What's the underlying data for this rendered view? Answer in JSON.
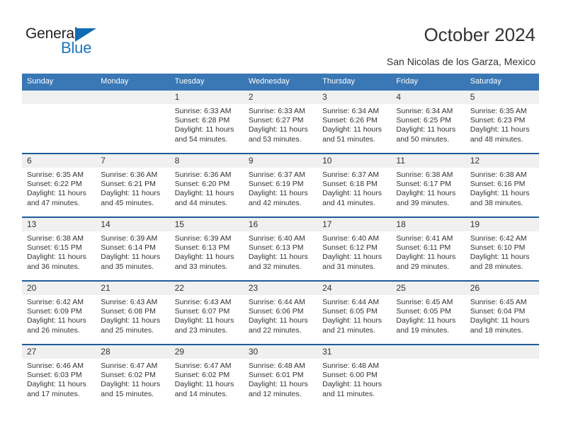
{
  "brand": {
    "name_part1": "General",
    "name_part2": "Blue",
    "triangle_color": "#0f6cb5",
    "blue_color": "#1b76bc"
  },
  "header": {
    "title": "October 2024",
    "subtitle": "San Nicolas de los Garza, Mexico"
  },
  "theme": {
    "header_blue": "#3a77b5",
    "row_divider_blue": "#1f5c99",
    "daynum_band_gray": "#f0f0f0",
    "text": "#333333"
  },
  "weekday_headers": [
    "Sunday",
    "Monday",
    "Tuesday",
    "Wednesday",
    "Thursday",
    "Friday",
    "Saturday"
  ],
  "weeks": [
    [
      {
        "day": "",
        "sunrise": "",
        "sunset": "",
        "daylight_line1": "",
        "daylight_line2": ""
      },
      {
        "day": "",
        "sunrise": "",
        "sunset": "",
        "daylight_line1": "",
        "daylight_line2": ""
      },
      {
        "day": "1",
        "sunrise": "Sunrise: 6:33 AM",
        "sunset": "Sunset: 6:28 PM",
        "daylight_line1": "Daylight: 11 hours",
        "daylight_line2": "and 54 minutes."
      },
      {
        "day": "2",
        "sunrise": "Sunrise: 6:33 AM",
        "sunset": "Sunset: 6:27 PM",
        "daylight_line1": "Daylight: 11 hours",
        "daylight_line2": "and 53 minutes."
      },
      {
        "day": "3",
        "sunrise": "Sunrise: 6:34 AM",
        "sunset": "Sunset: 6:26 PM",
        "daylight_line1": "Daylight: 11 hours",
        "daylight_line2": "and 51 minutes."
      },
      {
        "day": "4",
        "sunrise": "Sunrise: 6:34 AM",
        "sunset": "Sunset: 6:25 PM",
        "daylight_line1": "Daylight: 11 hours",
        "daylight_line2": "and 50 minutes."
      },
      {
        "day": "5",
        "sunrise": "Sunrise: 6:35 AM",
        "sunset": "Sunset: 6:23 PM",
        "daylight_line1": "Daylight: 11 hours",
        "daylight_line2": "and 48 minutes."
      }
    ],
    [
      {
        "day": "6",
        "sunrise": "Sunrise: 6:35 AM",
        "sunset": "Sunset: 6:22 PM",
        "daylight_line1": "Daylight: 11 hours",
        "daylight_line2": "and 47 minutes."
      },
      {
        "day": "7",
        "sunrise": "Sunrise: 6:36 AM",
        "sunset": "Sunset: 6:21 PM",
        "daylight_line1": "Daylight: 11 hours",
        "daylight_line2": "and 45 minutes."
      },
      {
        "day": "8",
        "sunrise": "Sunrise: 6:36 AM",
        "sunset": "Sunset: 6:20 PM",
        "daylight_line1": "Daylight: 11 hours",
        "daylight_line2": "and 44 minutes."
      },
      {
        "day": "9",
        "sunrise": "Sunrise: 6:37 AM",
        "sunset": "Sunset: 6:19 PM",
        "daylight_line1": "Daylight: 11 hours",
        "daylight_line2": "and 42 minutes."
      },
      {
        "day": "10",
        "sunrise": "Sunrise: 6:37 AM",
        "sunset": "Sunset: 6:18 PM",
        "daylight_line1": "Daylight: 11 hours",
        "daylight_line2": "and 41 minutes."
      },
      {
        "day": "11",
        "sunrise": "Sunrise: 6:38 AM",
        "sunset": "Sunset: 6:17 PM",
        "daylight_line1": "Daylight: 11 hours",
        "daylight_line2": "and 39 minutes."
      },
      {
        "day": "12",
        "sunrise": "Sunrise: 6:38 AM",
        "sunset": "Sunset: 6:16 PM",
        "daylight_line1": "Daylight: 11 hours",
        "daylight_line2": "and 38 minutes."
      }
    ],
    [
      {
        "day": "13",
        "sunrise": "Sunrise: 6:38 AM",
        "sunset": "Sunset: 6:15 PM",
        "daylight_line1": "Daylight: 11 hours",
        "daylight_line2": "and 36 minutes."
      },
      {
        "day": "14",
        "sunrise": "Sunrise: 6:39 AM",
        "sunset": "Sunset: 6:14 PM",
        "daylight_line1": "Daylight: 11 hours",
        "daylight_line2": "and 35 minutes."
      },
      {
        "day": "15",
        "sunrise": "Sunrise: 6:39 AM",
        "sunset": "Sunset: 6:13 PM",
        "daylight_line1": "Daylight: 11 hours",
        "daylight_line2": "and 33 minutes."
      },
      {
        "day": "16",
        "sunrise": "Sunrise: 6:40 AM",
        "sunset": "Sunset: 6:13 PM",
        "daylight_line1": "Daylight: 11 hours",
        "daylight_line2": "and 32 minutes."
      },
      {
        "day": "17",
        "sunrise": "Sunrise: 6:40 AM",
        "sunset": "Sunset: 6:12 PM",
        "daylight_line1": "Daylight: 11 hours",
        "daylight_line2": "and 31 minutes."
      },
      {
        "day": "18",
        "sunrise": "Sunrise: 6:41 AM",
        "sunset": "Sunset: 6:11 PM",
        "daylight_line1": "Daylight: 11 hours",
        "daylight_line2": "and 29 minutes."
      },
      {
        "day": "19",
        "sunrise": "Sunrise: 6:42 AM",
        "sunset": "Sunset: 6:10 PM",
        "daylight_line1": "Daylight: 11 hours",
        "daylight_line2": "and 28 minutes."
      }
    ],
    [
      {
        "day": "20",
        "sunrise": "Sunrise: 6:42 AM",
        "sunset": "Sunset: 6:09 PM",
        "daylight_line1": "Daylight: 11 hours",
        "daylight_line2": "and 26 minutes."
      },
      {
        "day": "21",
        "sunrise": "Sunrise: 6:43 AM",
        "sunset": "Sunset: 6:08 PM",
        "daylight_line1": "Daylight: 11 hours",
        "daylight_line2": "and 25 minutes."
      },
      {
        "day": "22",
        "sunrise": "Sunrise: 6:43 AM",
        "sunset": "Sunset: 6:07 PM",
        "daylight_line1": "Daylight: 11 hours",
        "daylight_line2": "and 23 minutes."
      },
      {
        "day": "23",
        "sunrise": "Sunrise: 6:44 AM",
        "sunset": "Sunset: 6:06 PM",
        "daylight_line1": "Daylight: 11 hours",
        "daylight_line2": "and 22 minutes."
      },
      {
        "day": "24",
        "sunrise": "Sunrise: 6:44 AM",
        "sunset": "Sunset: 6:05 PM",
        "daylight_line1": "Daylight: 11 hours",
        "daylight_line2": "and 21 minutes."
      },
      {
        "day": "25",
        "sunrise": "Sunrise: 6:45 AM",
        "sunset": "Sunset: 6:05 PM",
        "daylight_line1": "Daylight: 11 hours",
        "daylight_line2": "and 19 minutes."
      },
      {
        "day": "26",
        "sunrise": "Sunrise: 6:45 AM",
        "sunset": "Sunset: 6:04 PM",
        "daylight_line1": "Daylight: 11 hours",
        "daylight_line2": "and 18 minutes."
      }
    ],
    [
      {
        "day": "27",
        "sunrise": "Sunrise: 6:46 AM",
        "sunset": "Sunset: 6:03 PM",
        "daylight_line1": "Daylight: 11 hours",
        "daylight_line2": "and 17 minutes."
      },
      {
        "day": "28",
        "sunrise": "Sunrise: 6:47 AM",
        "sunset": "Sunset: 6:02 PM",
        "daylight_line1": "Daylight: 11 hours",
        "daylight_line2": "and 15 minutes."
      },
      {
        "day": "29",
        "sunrise": "Sunrise: 6:47 AM",
        "sunset": "Sunset: 6:02 PM",
        "daylight_line1": "Daylight: 11 hours",
        "daylight_line2": "and 14 minutes."
      },
      {
        "day": "30",
        "sunrise": "Sunrise: 6:48 AM",
        "sunset": "Sunset: 6:01 PM",
        "daylight_line1": "Daylight: 11 hours",
        "daylight_line2": "and 12 minutes."
      },
      {
        "day": "31",
        "sunrise": "Sunrise: 6:48 AM",
        "sunset": "Sunset: 6:00 PM",
        "daylight_line1": "Daylight: 11 hours",
        "daylight_line2": "and 11 minutes."
      },
      {
        "day": "",
        "sunrise": "",
        "sunset": "",
        "daylight_line1": "",
        "daylight_line2": ""
      },
      {
        "day": "",
        "sunrise": "",
        "sunset": "",
        "daylight_line1": "",
        "daylight_line2": ""
      }
    ]
  ]
}
